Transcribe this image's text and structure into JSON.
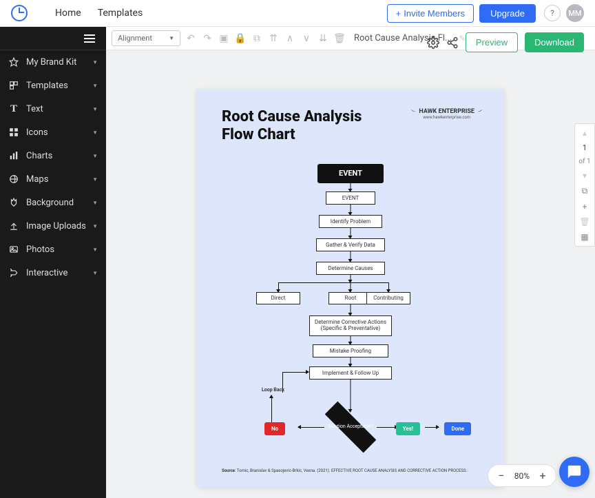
{
  "nav": {
    "home": "Home",
    "templates": "Templates"
  },
  "header": {
    "invite": "Invite Members",
    "upgrade": "Upgrade",
    "help": "?",
    "avatar": "MM"
  },
  "sidebar": {
    "items": [
      {
        "label": "My Brand Kit",
        "icon": "star"
      },
      {
        "label": "Templates",
        "icon": "templates"
      },
      {
        "label": "Text",
        "icon": "text"
      },
      {
        "label": "Icons",
        "icon": "icons"
      },
      {
        "label": "Charts",
        "icon": "charts"
      },
      {
        "label": "Maps",
        "icon": "maps"
      },
      {
        "label": "Background",
        "icon": "background"
      },
      {
        "label": "Image Uploads",
        "icon": "upload"
      },
      {
        "label": "Photos",
        "icon": "photos"
      },
      {
        "label": "Interactive",
        "icon": "interactive"
      }
    ]
  },
  "toolbar": {
    "alignment": "Alignment",
    "doc_title": "Root Cause Analysis Fl..."
  },
  "actions": {
    "preview": "Preview",
    "download": "Download"
  },
  "pages": {
    "current": "1",
    "total": "of 1"
  },
  "zoom": {
    "level": "80%"
  },
  "canvas": {
    "title_l1": "Root Cause Analysis",
    "title_l2": "Flow Chart",
    "brand_name": "HAWK ENTERPRISE",
    "brand_url": "www.hawkenterprise.com",
    "nodes": {
      "event_main": "EVENT",
      "event": "EVENT",
      "identify": "Identify Problem",
      "gather": "Gather & Verify Data",
      "determine": "Determine Causes",
      "direct": "Direct",
      "root": "Root",
      "contributing": "Contributing",
      "corrective": "Determine Corrective Actions (Specific & Preventative)",
      "mistake": "Mistake Proofing",
      "implement": "Implement & Follow Up",
      "decision": "Solution Acceptable?",
      "no": "No",
      "yes": "Yes!",
      "done": "Done",
      "loop": "Loop Back"
    },
    "source_label": "Source",
    "source_text": ": Tomic, Branislav & Spasojevic-Brkic, Vesna. (2021). EFFECTIVE ROOT CAUSE ANALYSIS AND CORRECTIVE ACTION PROCESS."
  }
}
